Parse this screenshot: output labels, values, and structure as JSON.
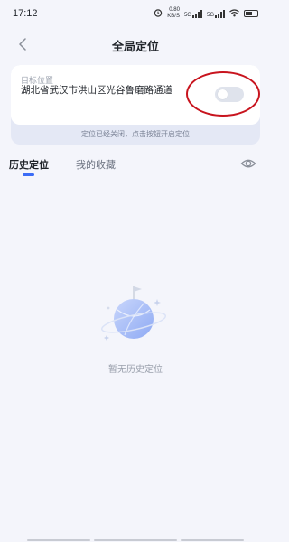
{
  "status_bar": {
    "time": "17:12",
    "net_speed_value": "0.80",
    "net_speed_unit": "KB/S",
    "signal_1": "5G",
    "signal_2": "5G"
  },
  "header": {
    "title": "全局定位"
  },
  "location_card": {
    "label": "目标位置",
    "address": "湖北省武汉市洪山区光谷鲁磨路通道",
    "toggle_on": false,
    "hint": "定位已经关闭，点击按钮开启定位"
  },
  "tabs": [
    {
      "label": "历史定位",
      "active": true
    },
    {
      "label": "我的收藏",
      "active": false
    }
  ],
  "empty_state": {
    "text": "暂无历史定位"
  },
  "colors": {
    "accent": "#3b6cf6",
    "annotation": "#c8141e",
    "background": "#f4f5fb"
  }
}
